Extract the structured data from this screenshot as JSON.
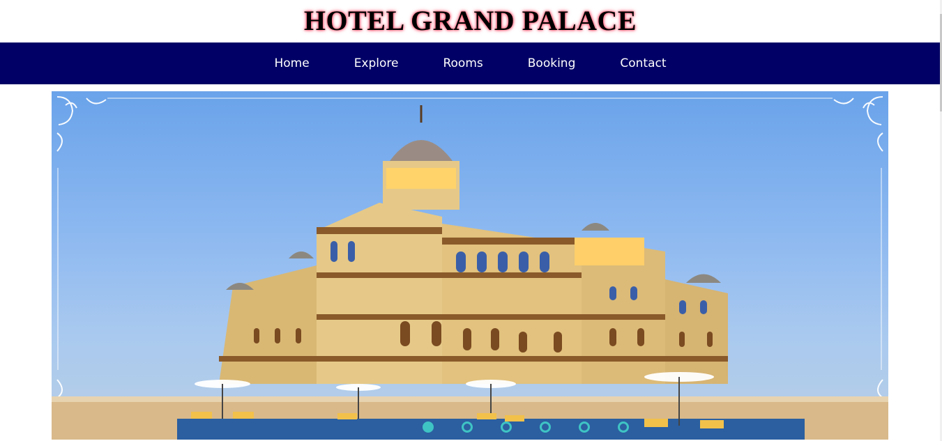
{
  "header": {
    "title": "HOTEL GRAND PALACE"
  },
  "nav": {
    "items": [
      {
        "label": "Home"
      },
      {
        "label": "Explore"
      },
      {
        "label": "Rooms"
      },
      {
        "label": "Booking"
      },
      {
        "label": "Contact"
      }
    ]
  },
  "slider": {
    "image": "hotel-palace-photo",
    "dot_count": 6,
    "active_dot": 1
  },
  "colors": {
    "nav_background": "#000066",
    "title_glow": "#ff4d6a",
    "dot_accent": "#3fc4c4"
  }
}
